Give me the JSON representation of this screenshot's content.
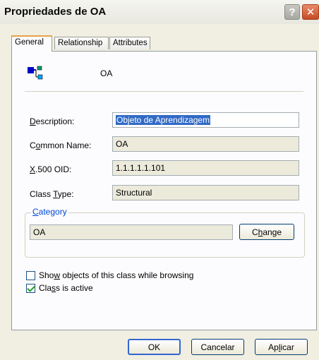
{
  "window": {
    "title": "Propriedades de OA",
    "help_glyph": "?",
    "close_glyph": "✕"
  },
  "tabs": [
    {
      "label": "General",
      "active": true
    },
    {
      "label": "Relationship",
      "active": false
    },
    {
      "label": "Attributes",
      "active": false
    }
  ],
  "general": {
    "class_name": "OA",
    "icon": "class-schema-icon",
    "description": {
      "label_first": "D",
      "label_rest": "escription:",
      "value": "Objeto de Aprendizagem"
    },
    "common_name": {
      "label_first": "C",
      "label_mid": "o",
      "label_rest": "mmon Name:",
      "value": "OA"
    },
    "oid": {
      "label_first": "X",
      "label_rest": ".500 OID:",
      "value": "1.1.1.1.1.101"
    },
    "class_type": {
      "label_pre": "Class ",
      "label_u": "T",
      "label_rest": "ype:",
      "value": "Structural"
    },
    "category": {
      "title_u": "C",
      "title_rest": "ategory",
      "value": "OA",
      "button_pre": "C",
      "button_u": "h",
      "button_rest": "ange"
    },
    "show_objects": {
      "pre": "Sho",
      "u": "w",
      "rest": " objects of this class while browsing",
      "checked": false
    },
    "class_active": {
      "pre": "Cla",
      "u": "s",
      "rest": "s is active",
      "checked": true
    }
  },
  "buttons": {
    "ok": "OK",
    "cancel": "Cancelar",
    "apply_pre": "Ap",
    "apply_u": "l",
    "apply_rest": "icar"
  },
  "colors": {
    "accent": "#316ac5",
    "dialog_bg": "#f1efe2",
    "tab_highlight": "#e7a24a"
  }
}
